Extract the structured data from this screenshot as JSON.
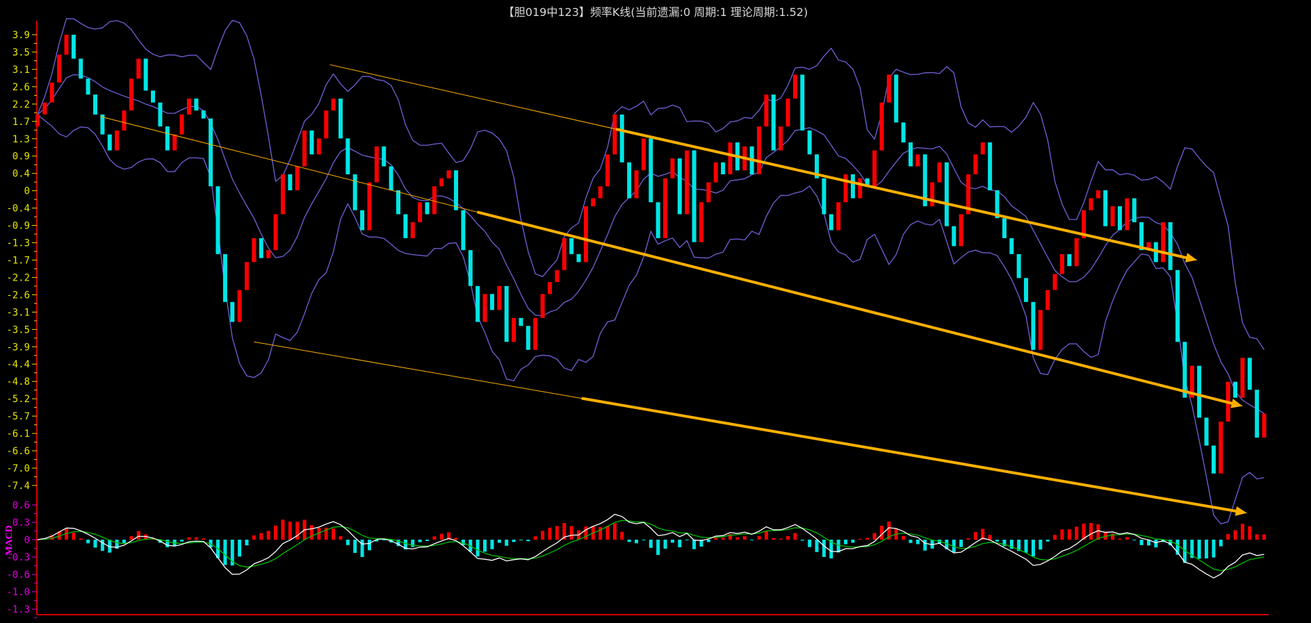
{
  "title": "【胆019中123】频率K线(当前遗漏:0 周期:1 理论周期:1.52)",
  "chart_data": {
    "type": "candlestick",
    "title": "【胆019中123】频率K线(当前遗漏:0 周期:1 理论周期:1.52)",
    "main_pane": {
      "ylim": [
        -7.6,
        4.1
      ],
      "y_ticks": [
        "3.9",
        "3.5",
        "3.1",
        "2.6",
        "2.2",
        "1.7",
        "1.3",
        "0.9",
        "0.4",
        "0",
        "-0.4",
        "-0.9",
        "-1.3",
        "-1.7",
        "-2.2",
        "-2.6",
        "-3.1",
        "-3.5",
        "-3.9",
        "-4.4",
        "-4.8",
        "-5.2",
        "-5.7",
        "-6.1",
        "-6.6",
        "-7.0",
        "-7.4"
      ],
      "y_tick_values": [
        3.9,
        3.465,
        3.031,
        2.596,
        2.162,
        1.727,
        1.292,
        0.858,
        0.423,
        0,
        -0.446,
        -0.881,
        -1.315,
        -1.75,
        -2.185,
        -2.619,
        -3.054,
        -3.488,
        -3.923,
        -4.358,
        -4.792,
        -5.227,
        -5.662,
        -6.096,
        -6.531,
        -6.965,
        -7.4
      ],
      "closes": [
        1.9,
        2.2,
        2.7,
        3.4,
        3.9,
        3.3,
        2.8,
        2.4,
        1.9,
        1.4,
        1.0,
        1.5,
        2.0,
        2.8,
        3.3,
        2.5,
        2.2,
        1.6,
        1.0,
        1.4,
        1.9,
        2.3,
        2.0,
        1.8,
        0.1,
        -1.6,
        -2.8,
        -3.3,
        -2.5,
        -1.8,
        -1.2,
        -1.7,
        -1.5,
        -0.6,
        0.4,
        0.0,
        0.6,
        1.5,
        0.9,
        1.3,
        2.0,
        2.3,
        1.3,
        0.4,
        -0.5,
        -1.0,
        0.2,
        1.1,
        0.6,
        0.0,
        -0.6,
        -1.2,
        -0.8,
        -0.3,
        -0.6,
        0.1,
        0.3,
        0.5,
        -0.5,
        -1.5,
        -2.4,
        -3.3,
        -2.6,
        -3.0,
        -2.4,
        -3.8,
        -3.2,
        -3.4,
        -4.0,
        -3.2,
        -2.6,
        -2.3,
        -2.0,
        -1.2,
        -1.6,
        -1.8,
        -0.4,
        -0.2,
        0.1,
        0.9,
        1.9,
        0.7,
        -0.2,
        0.5,
        1.3,
        -0.3,
        -1.2,
        0.3,
        0.8,
        -0.6,
        1.0,
        -1.3,
        -0.3,
        0.2,
        0.7,
        0.4,
        1.2,
        0.5,
        1.1,
        0.4,
        1.6,
        2.4,
        1.0,
        1.6,
        2.3,
        2.9,
        1.5,
        0.9,
        0.3,
        -0.6,
        -1.0,
        -0.3,
        0.4,
        -0.2,
        0.3,
        0.1,
        1.0,
        2.2,
        2.9,
        1.7,
        1.2,
        0.6,
        0.9,
        -0.4,
        0.2,
        0.7,
        -0.9,
        -1.4,
        -0.6,
        0.4,
        0.9,
        1.2,
        0.0,
        -0.7,
        -1.2,
        -1.6,
        -2.2,
        -2.8,
        -4.0,
        -3.0,
        -2.5,
        -2.1,
        -1.6,
        -1.9,
        -1.2,
        -0.5,
        -0.2,
        0.0,
        -0.9,
        -0.4,
        -1.0,
        -0.2,
        -0.8,
        -1.5,
        -1.3,
        -1.8,
        -0.8,
        -2.0,
        -3.8,
        -5.2,
        -4.4,
        -5.7,
        -6.4,
        -7.1,
        -5.8,
        -4.8,
        -5.2,
        -4.2,
        -5.0,
        -6.2,
        -5.6
      ],
      "up_color": "#ff0000",
      "down_color": "#00e5e5",
      "bollinger": {
        "period": 10,
        "k": 2,
        "color": "#6f62d8"
      },
      "trend_arrows": [
        {
          "from": [
            40.5,
            3.15
          ],
          "to": [
            160.7,
            -1.75
          ],
          "color": "#ffb000"
        },
        {
          "from": [
            8.7,
            1.85
          ],
          "to": [
            167.0,
            -5.41
          ],
          "color": "#ffb000"
        },
        {
          "from": [
            30.0,
            -3.8
          ],
          "to": [
            167.6,
            -8.09
          ],
          "color": "#ffb000"
        }
      ]
    },
    "macd_pane": {
      "label": "MACD",
      "ylim": [
        -1.4,
        0.75
      ],
      "y_ticks": [
        "0.6",
        "0.3",
        "0",
        "-0.3",
        "-0.6",
        "-1.0",
        "-1.3"
      ],
      "y_tick_values": [
        0.6,
        0.3,
        0,
        -0.3,
        -0.6,
        -0.9,
        -1.2
      ],
      "params": {
        "fast": 6,
        "slow": 13,
        "signal": 5
      },
      "dif_color": "#ffffff",
      "dea_color": "#00c000",
      "hist_pos_color": "#ff0000",
      "hist_neg_color": "#00e5e5"
    },
    "axis_color": "#d00000"
  }
}
